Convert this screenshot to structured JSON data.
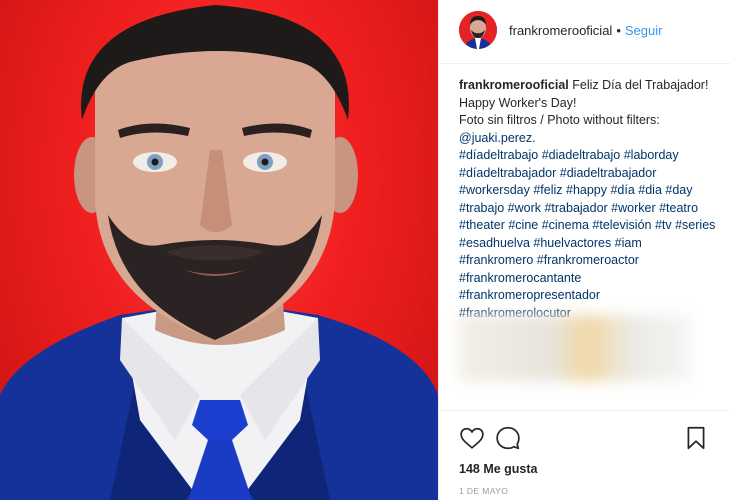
{
  "post": {
    "photo_alt": "portrait photo",
    "header": {
      "username": "frankromerooficial",
      "separator": "•",
      "follow_label": "Seguir"
    },
    "caption": {
      "username": "frankromerooficial",
      "lines": [
        "Feliz Día del Trabajador!",
        "Happy Worker's Day!",
        "Foto sin filtros / Photo without filters:",
        "@juaki.perez.",
        "#díadeltrabajo #diadeltrabajo #laborday",
        "#díadeltrabajador #diadeltrabajador",
        "#workersday #feliz #happy #día #dia #day",
        "#trabajo #work #trabajador #worker #teatro",
        "#theater #cine #cinema #televisión #tv #series",
        "#esadhuelva #huelvactores #iam",
        "#frankromero #frankromeroactor",
        "#frankromerocantante",
        "#frankromeropresentador",
        "#frankromerolocutor"
      ]
    },
    "icons": {
      "like": "heart-icon",
      "comment": "comment-icon",
      "save": "bookmark-icon"
    },
    "likes": "148 Me gusta",
    "date": "1 DE MAYO"
  },
  "colors": {
    "photo_background": "#f01f1f",
    "follow_link": "#3897f0",
    "hashtag": "#003569",
    "suit": "#15329a"
  }
}
